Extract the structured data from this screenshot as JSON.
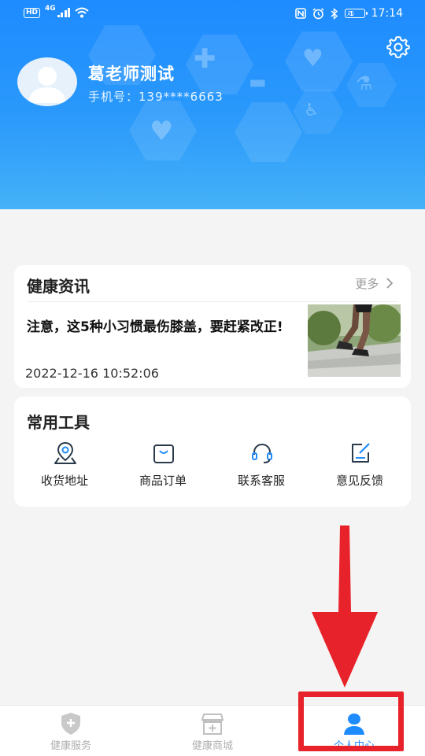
{
  "status_bar": {
    "hd": "HD",
    "net": "4G",
    "battery": "66",
    "time": "17:14"
  },
  "profile": {
    "name": "葛老师测试",
    "phone_label": "手机号：",
    "phone": "139****6663"
  },
  "news": {
    "title": "健康资讯",
    "more_label": "更多",
    "headline": "注意，这5种小习惯最伤膝盖，要赶紧改正!",
    "date": "2022-12-16 10:52:06"
  },
  "tools": {
    "title": "常用工具",
    "items": [
      {
        "label": "收货地址",
        "icon": "location-pin-icon"
      },
      {
        "label": "商品订单",
        "icon": "shopping-bag-icon"
      },
      {
        "label": "联系客服",
        "icon": "headset-icon"
      },
      {
        "label": "意见反馈",
        "icon": "edit-feedback-icon"
      }
    ]
  },
  "bottom_nav": {
    "items": [
      {
        "label": "健康服务",
        "icon": "shield-plus-icon",
        "active": false
      },
      {
        "label": "健康商城",
        "icon": "store-icon",
        "active": false
      },
      {
        "label": "个人中心",
        "icon": "person-icon",
        "active": true
      }
    ]
  },
  "colors": {
    "primary": "#1E8BFF",
    "nav_inactive": "#B0B0B0",
    "annotation": "#E8222A"
  }
}
